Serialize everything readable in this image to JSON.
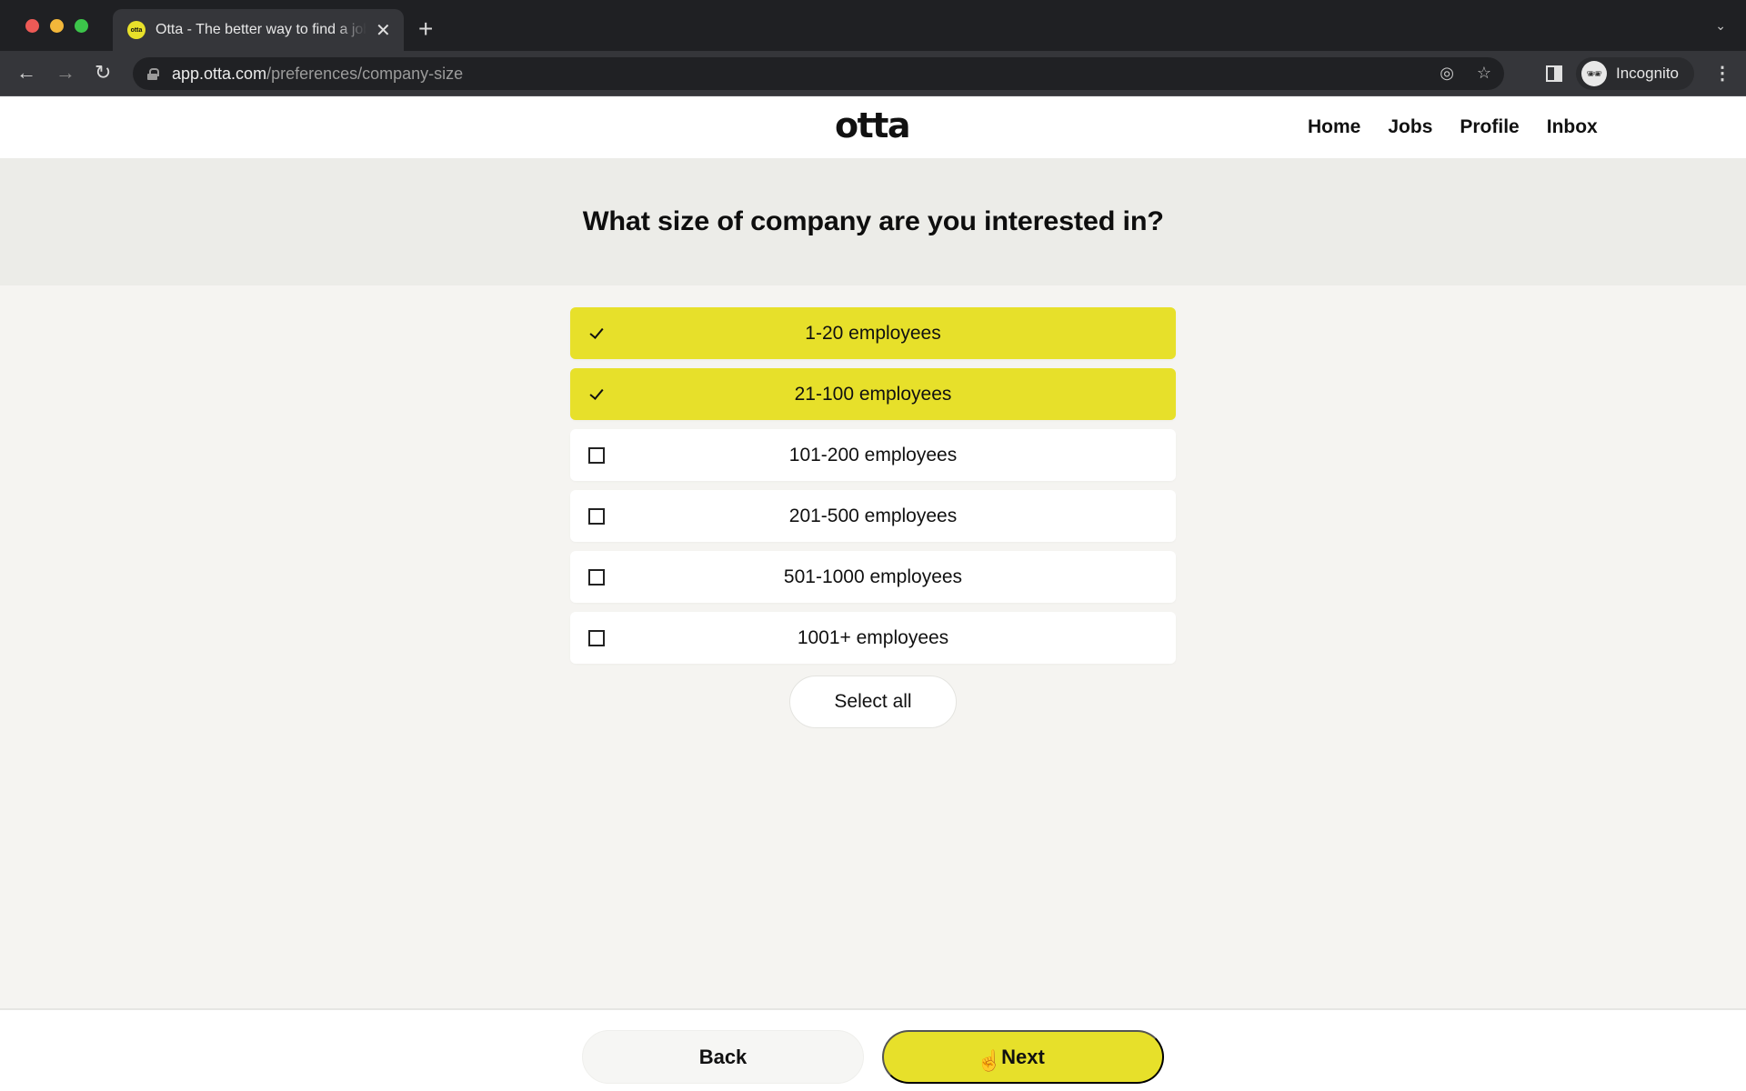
{
  "browser": {
    "tab_title": "Otta - The better way to find a job",
    "tab_favicon_text": "otta",
    "new_tab_symbol": "+",
    "close_symbol": "✕",
    "url_host": "app.otta.com",
    "url_path": "/preferences/company-size",
    "profile_label": "Incognito",
    "icons": {
      "back": "←",
      "forward": "→",
      "reload": "↻",
      "eye_off": "◎",
      "star": "☆",
      "menu": "⋮",
      "tab_dropdown": "⌄",
      "incognito": "🕶"
    }
  },
  "site": {
    "logo": "otta",
    "nav": [
      "Home",
      "Jobs",
      "Profile",
      "Inbox"
    ]
  },
  "question": "What size of company are you interested in?",
  "options": [
    {
      "label": "1-20 employees",
      "selected": true
    },
    {
      "label": "21-100 employees",
      "selected": true
    },
    {
      "label": "101-200 employees",
      "selected": false
    },
    {
      "label": "201-500 employees",
      "selected": false
    },
    {
      "label": "501-1000 employees",
      "selected": false
    },
    {
      "label": "1001+ employees",
      "selected": false
    }
  ],
  "select_all_label": "Select all",
  "footer": {
    "back_label": "Back",
    "next_label": "Next"
  },
  "colors": {
    "accent_yellow": "#e7e02a",
    "page_bg": "#f5f4f1"
  }
}
